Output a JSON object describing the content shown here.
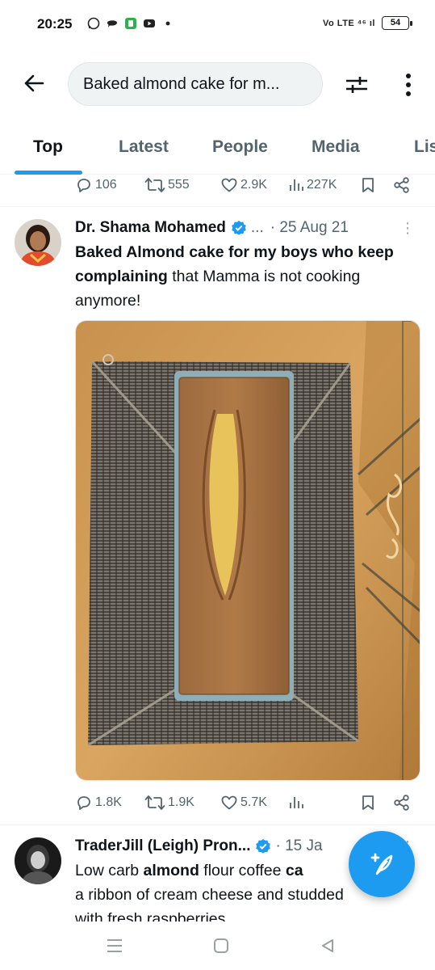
{
  "status_bar": {
    "time": "20:25",
    "battery": "54",
    "network": "Vo LTE ⁴⁶ ıl"
  },
  "search": {
    "query": "Baked almond cake for m..."
  },
  "tabs": [
    {
      "label": "Top",
      "active": true
    },
    {
      "label": "Latest",
      "active": false
    },
    {
      "label": "People",
      "active": false
    },
    {
      "label": "Media",
      "active": false
    },
    {
      "label": "Lis",
      "active": false
    }
  ],
  "prev_tweet": {
    "replies": "106",
    "retweets": "555",
    "likes": "2.9K",
    "views": "227K"
  },
  "tweet1": {
    "name": "Dr. Shama Mohamed",
    "handle_truncated": "...",
    "date": "· 25 Aug 21",
    "more": "⋮",
    "text_bold": "Baked Almond cake for my boys who keep complaining",
    "text_rest": " that Mamma is not cooking anymore!",
    "replies": "1.8K",
    "retweets": "1.9K",
    "likes": "5.7K"
  },
  "tweet2": {
    "name": "TraderJill (Leigh) Pron...",
    "date": "· 15 Ja",
    "more": "⋮",
    "text_a": "Low carb ",
    "text_b": "almond",
    "text_c": " flour coffee ",
    "text_d": "ca",
    "line2": "a ribbon of cream cheese and studded",
    "line3": "with fresh raspberries"
  },
  "colors": {
    "accent": "#1d9bf0",
    "secondary_text": "#536471",
    "primary_text": "#0f1419"
  },
  "icons": [
    "back-arrow-icon",
    "filter-icon",
    "more-vertical-icon",
    "reply-icon",
    "retweet-icon",
    "like-icon",
    "views-icon",
    "bookmark-icon",
    "share-icon",
    "verified-badge-icon",
    "compose-icon"
  ]
}
